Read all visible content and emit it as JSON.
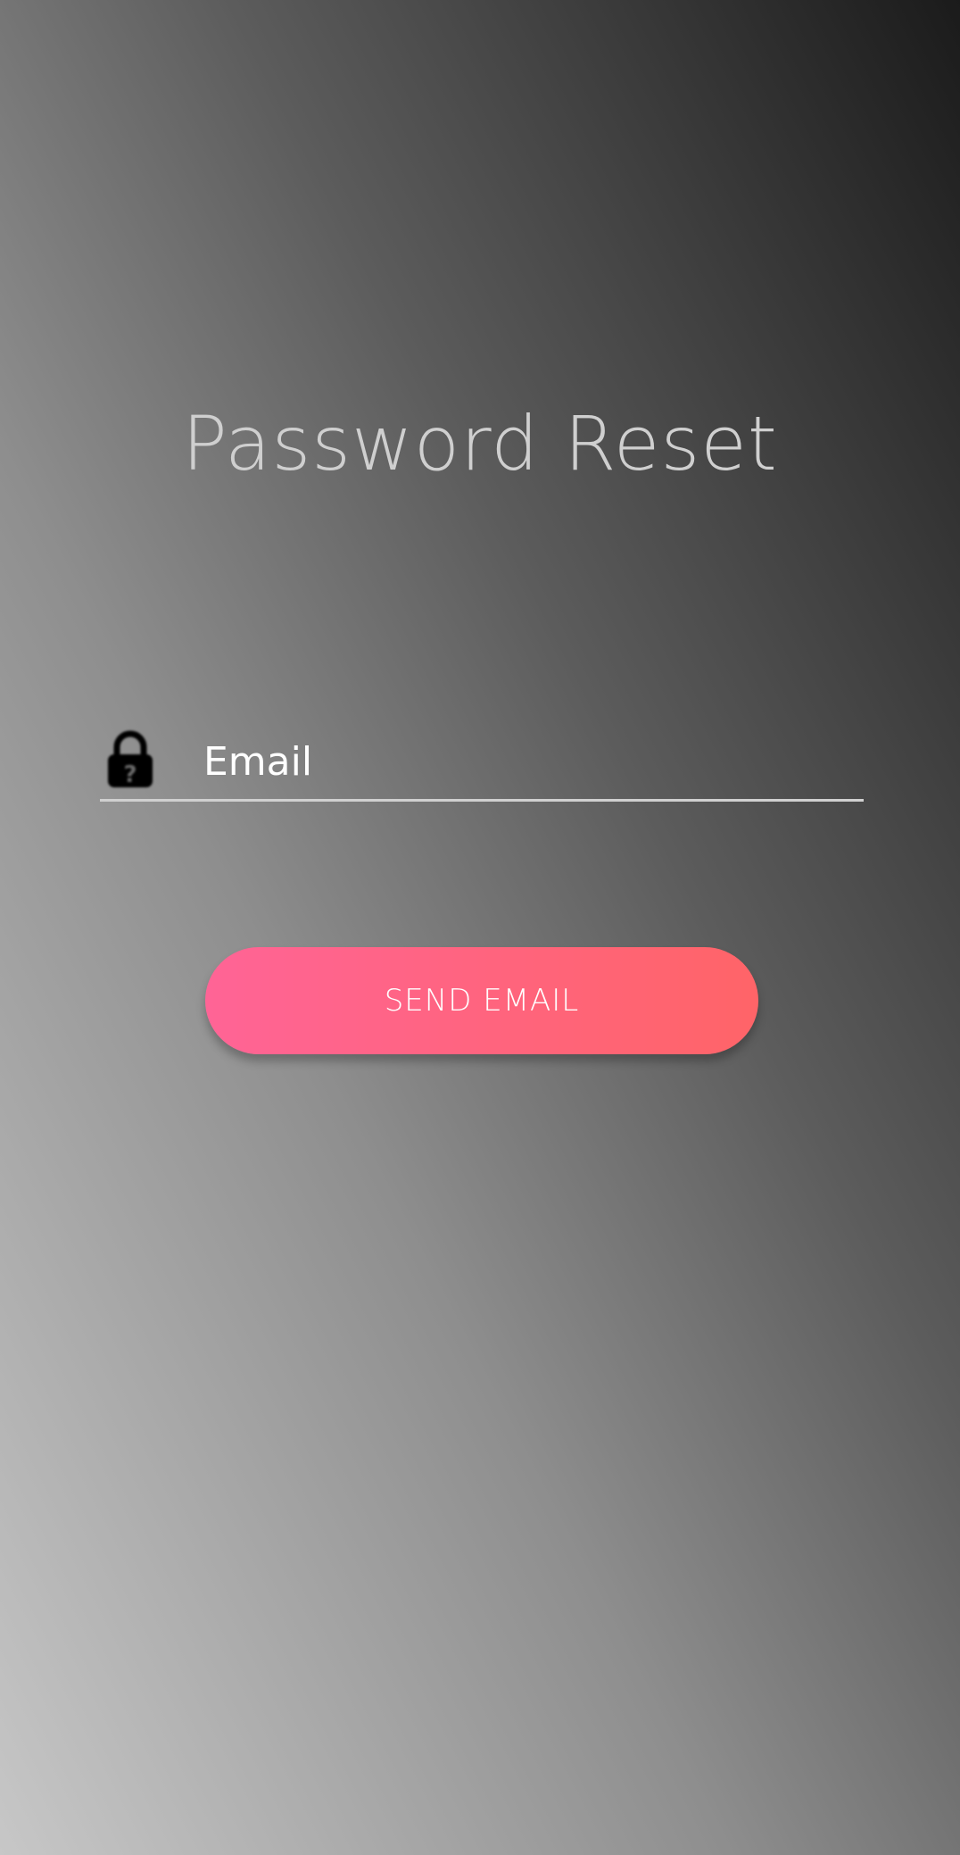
{
  "page": {
    "title": "Password Reset"
  },
  "form": {
    "email_placeholder": "Email",
    "email_value": "",
    "lock_icon": "lock-question-icon"
  },
  "actions": {
    "send_label": "SEND EMAIL"
  },
  "colors": {
    "button_gradient_start": "#ff6496",
    "button_gradient_end": "#ff6468",
    "title_text": "#cfcfcf",
    "input_underline": "#d0d0d0"
  }
}
